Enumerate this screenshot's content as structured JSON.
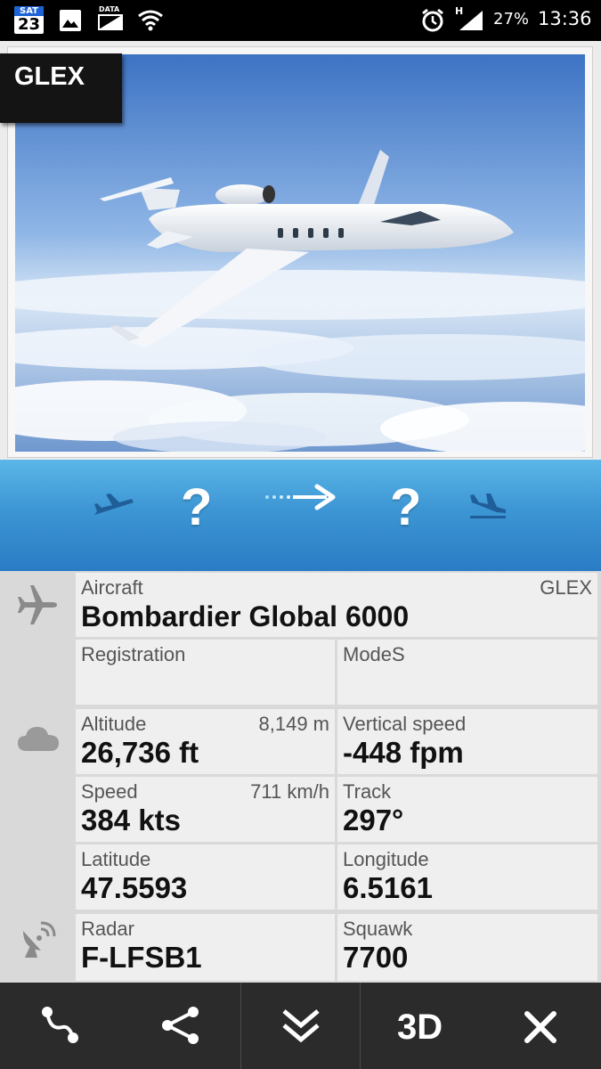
{
  "status_bar": {
    "calendar_day_name": "SAT",
    "calendar_day_number": "23",
    "data_label": "DATA",
    "network_type": "H",
    "battery": "27%",
    "time": "13:36",
    "icons": [
      "calendar-icon",
      "gallery-icon",
      "data-saver-icon",
      "wifi-icon",
      "alarm-icon",
      "signal-icon"
    ]
  },
  "photo": {
    "type_badge": "GLEX",
    "image": "business-jet-over-clouds"
  },
  "route": {
    "origin": "?",
    "destination": "?",
    "icons": [
      "takeoff-icon",
      "route-arrow-icon",
      "landing-icon"
    ]
  },
  "aircraft": {
    "label": "Aircraft",
    "type_code": "GLEX",
    "model": "Bombardier Global 6000",
    "registration_label": "Registration",
    "registration_value": "",
    "modes_label": "ModeS",
    "modes_value": ""
  },
  "flight": {
    "altitude_label": "Altitude",
    "altitude_metric": "8,149 m",
    "altitude_value": "26,736 ft",
    "vertical_speed_label": "Vertical speed",
    "vertical_speed_value": "-448 fpm",
    "speed_label": "Speed",
    "speed_metric": "711 km/h",
    "speed_value": "384 kts",
    "track_label": "Track",
    "track_value": "297°",
    "latitude_label": "Latitude",
    "latitude_value": "47.5593",
    "longitude_label": "Longitude",
    "longitude_value": "6.5161"
  },
  "radar": {
    "radar_label": "Radar",
    "radar_value": "F-LFSB1",
    "squawk_label": "Squawk",
    "squawk_value": "7700"
  },
  "toolbar": {
    "route_icon": "route-icon",
    "share_icon": "share-icon",
    "collapse_icon": "chevron-double-down-icon",
    "three_d_label": "3D",
    "close_icon": "close-icon"
  },
  "colors": {
    "route_bar": "#3d96d4",
    "toolbar": "#2b2b2b",
    "cell": "#efefef"
  }
}
